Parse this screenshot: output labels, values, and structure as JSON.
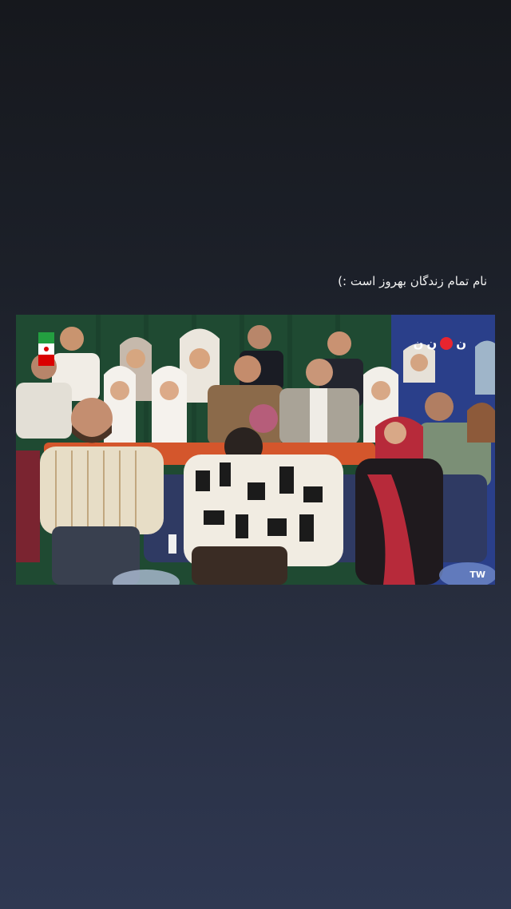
{
  "story": {
    "caption": "نام تمام زندگان بهروز است :)"
  },
  "video": {
    "channel_logo_text": "ن ن ن",
    "watermark": "TW",
    "flag_icon": "iran-flag-icon"
  },
  "colors": {
    "curtain": "#1f4a32",
    "sofa": "#d4562c",
    "stage_blue": "#2a3f8a",
    "logo_red": "#e8252f"
  }
}
